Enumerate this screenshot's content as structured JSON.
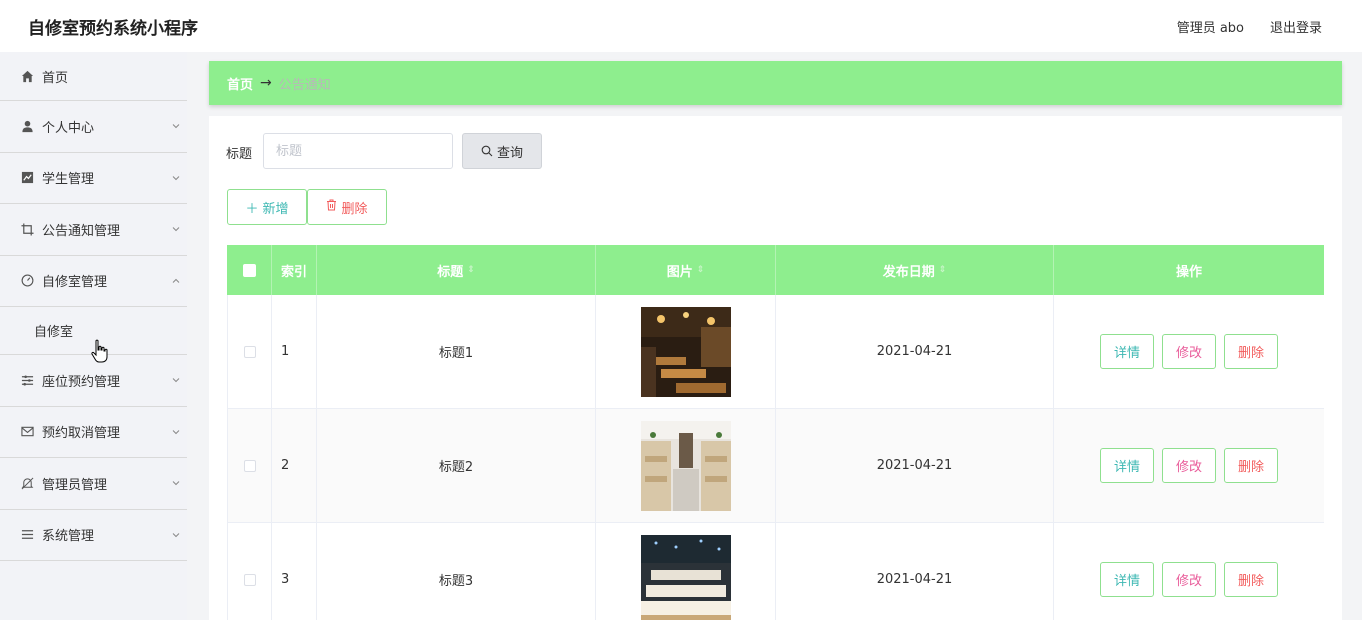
{
  "header": {
    "app_title": "自修室预约系统小程序",
    "user_info": "管理员 abo",
    "logout": "退出登录"
  },
  "sidebar": {
    "home": "首页",
    "items": [
      {
        "label": "个人中心",
        "icon": "user-icon"
      },
      {
        "label": "学生管理",
        "icon": "chart-icon"
      },
      {
        "label": "公告通知管理",
        "icon": "crop-icon"
      },
      {
        "label": "自修室管理",
        "icon": "gauge-icon",
        "expanded": true
      },
      {
        "label": "座位预约管理",
        "icon": "list-icon"
      },
      {
        "label": "预约取消管理",
        "icon": "mail-icon"
      },
      {
        "label": "管理员管理",
        "icon": "bell-off-icon"
      },
      {
        "label": "系统管理",
        "icon": "menu-icon"
      }
    ],
    "submenu": [
      "自修室"
    ]
  },
  "breadcrumb": {
    "home": "首页",
    "arrow": "→",
    "current": "公告通知"
  },
  "search": {
    "label": "标题",
    "placeholder": "标题",
    "button": "查询"
  },
  "actions": {
    "add": "新增",
    "delete": "删除"
  },
  "table": {
    "headers": [
      "索引",
      "标题",
      "图片",
      "发布日期",
      "操作"
    ],
    "rows": [
      {
        "index": "1",
        "title": "标题1",
        "date": "2021-04-21"
      },
      {
        "index": "2",
        "title": "标题2",
        "date": "2021-04-21"
      },
      {
        "index": "3",
        "title": "标题3",
        "date": "2021-04-21"
      }
    ],
    "ops": {
      "detail": "详情",
      "edit": "修改",
      "delete": "删除"
    }
  },
  "colors": {
    "accent_green": "#8eee8e",
    "teal": "#3eb8b3",
    "pink": "#e95c9a",
    "red": "#f25b5b"
  }
}
